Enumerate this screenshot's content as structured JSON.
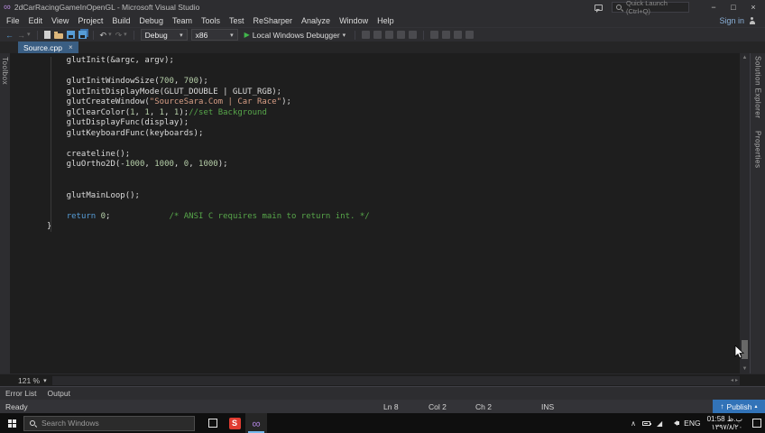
{
  "window": {
    "title": "2dCarRacingGameInOpenGL - Microsoft Visual Studio",
    "quick_launch_placeholder": "Quick Launch (Ctrl+Q)"
  },
  "menu": {
    "items": [
      "File",
      "Edit",
      "View",
      "Project",
      "Build",
      "Debug",
      "Team",
      "Tools",
      "Test",
      "ReSharper",
      "Analyze",
      "Window",
      "Help"
    ],
    "sign_in": "Sign in"
  },
  "toolbar": {
    "configuration": "Debug",
    "platform": "x86",
    "run_label": "Local Windows Debugger"
  },
  "editor": {
    "tab_label": "Source.cpp",
    "zoom": "121 %",
    "lines": [
      [
        [
          "p",
          "    glutInit(&argc, argv);"
        ]
      ],
      [],
      [
        [
          "p",
          "    glutInitWindowSize("
        ],
        [
          "n",
          "700"
        ],
        [
          "p",
          ", "
        ],
        [
          "n",
          "700"
        ],
        [
          "p",
          ");"
        ]
      ],
      [
        [
          "p",
          "    glutInitDisplayMode(GLUT_DOUBLE | GLUT_RGB);"
        ]
      ],
      [
        [
          "p",
          "    glutCreateWindow("
        ],
        [
          "s",
          "\"SourceSara.Com | Car Race\""
        ],
        [
          "p",
          ");"
        ]
      ],
      [
        [
          "p",
          "    glClearColor("
        ],
        [
          "n",
          "1"
        ],
        [
          "p",
          ", "
        ],
        [
          "n",
          "1"
        ],
        [
          "p",
          ", "
        ],
        [
          "n",
          "1"
        ],
        [
          "p",
          ", "
        ],
        [
          "n",
          "1"
        ],
        [
          "p",
          ");"
        ],
        [
          "c",
          "//set Background"
        ]
      ],
      [
        [
          "p",
          "    glutDisplayFunc(display);"
        ]
      ],
      [
        [
          "p",
          "    glutKeyboardFunc(keyboards);"
        ]
      ],
      [],
      [
        [
          "p",
          "    createline();"
        ]
      ],
      [
        [
          "p",
          "    gluOrtho2D(-"
        ],
        [
          "n",
          "1000"
        ],
        [
          "p",
          ", "
        ],
        [
          "n",
          "1000"
        ],
        [
          "p",
          ", "
        ],
        [
          "n",
          "0"
        ],
        [
          "p",
          ", "
        ],
        [
          "n",
          "1000"
        ],
        [
          "p",
          ");"
        ]
      ],
      [],
      [],
      [
        [
          "p",
          "    glutMainLoop();"
        ]
      ],
      [],
      [
        [
          "p",
          "    "
        ],
        [
          "k",
          "return"
        ],
        [
          "p",
          " "
        ],
        [
          "n",
          "0"
        ],
        [
          "p",
          ";            "
        ],
        [
          "c",
          "/* ANSI C requires main to return int. */"
        ]
      ],
      [
        [
          "p",
          "}"
        ]
      ]
    ]
  },
  "side_tabs": {
    "left": "Toolbox",
    "right": [
      "Solution Explorer",
      "Properties"
    ]
  },
  "bottom_panel": {
    "tabs": [
      "Error List",
      "Output"
    ]
  },
  "status_bar": {
    "state": "Ready",
    "line": "Ln 8",
    "column": "Col 2",
    "character": "Ch 2",
    "mode": "INS",
    "publish": "Publish"
  },
  "taskbar": {
    "search_placeholder": "Search Windows",
    "app_s_label": "S",
    "tray": {
      "language": "ENG",
      "time": "01:58 ب.ظ",
      "date": "۱۳۹۷/۸/۲۰"
    }
  },
  "icons": {
    "vs_logo": "∞",
    "minimize": "−",
    "maximize": "□",
    "close": "×",
    "back": "←",
    "forward": "→",
    "caret": "▾",
    "undo": "↶",
    "redo": "↷",
    "run": "▶",
    "scroll_up": "▲",
    "scroll_down": "▼",
    "scroll_left": "◂",
    "scroll_right": "▸",
    "tray_chevron": "∧",
    "network": "◢",
    "publish_up": "↑",
    "publish_caret": "▴",
    "search_icon": "css-magnifier",
    "person_icon": "css-person",
    "feedback_icon": "css-bubble"
  },
  "colors": {
    "titlebar_bg": "#2d2d30",
    "editor_bg": "#1e1e1e",
    "tab_active_bg": "#3a5e83",
    "publish_bg": "#3273b8",
    "taskbar_bg": "#0f0f0f",
    "string": "#d69d85",
    "comment": "#57a64a",
    "keyword": "#569cd6",
    "number": "#b5cea8",
    "run_green": "#41b64b",
    "app_s_red": "#e03c31",
    "vs_purple": "#a97fd6"
  }
}
